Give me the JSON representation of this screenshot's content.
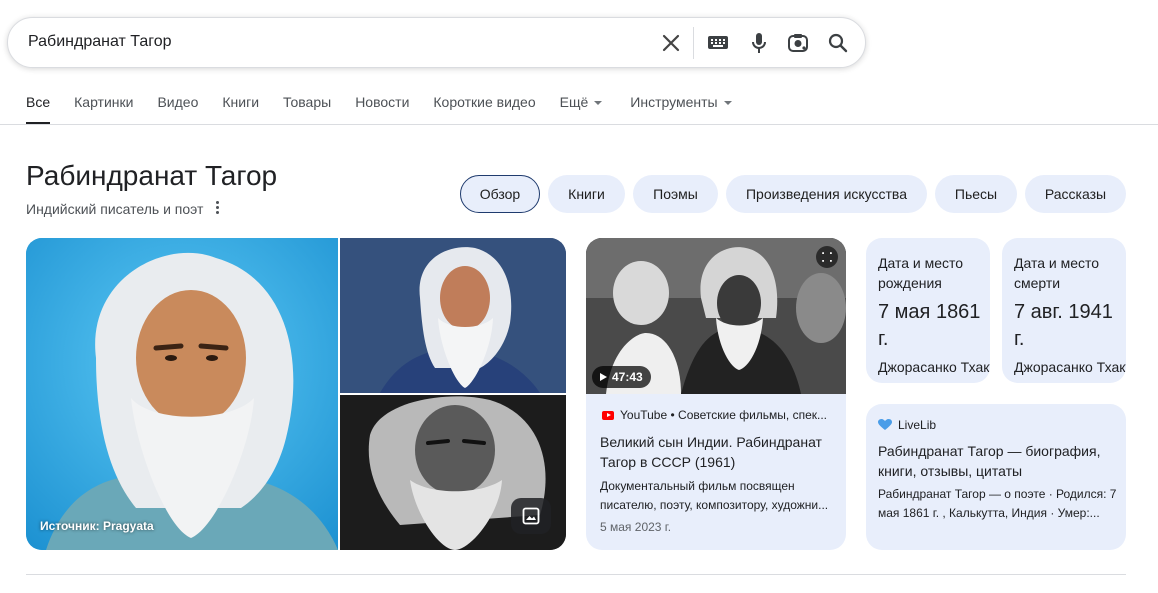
{
  "search": {
    "query": "Рабиндранат Тагор"
  },
  "tabs": [
    {
      "label": "Все"
    },
    {
      "label": "Картинки"
    },
    {
      "label": "Видео"
    },
    {
      "label": "Книги"
    },
    {
      "label": "Товары"
    },
    {
      "label": "Новости"
    },
    {
      "label": "Короткие видео"
    },
    {
      "label": "Ещё"
    },
    {
      "label": "Инструменты"
    }
  ],
  "entity": {
    "title": "Рабиндранат Тагор",
    "subtitle": "Индийский писатель и поэт"
  },
  "chips": [
    {
      "label": "Обзор"
    },
    {
      "label": "Книги"
    },
    {
      "label": "Поэмы"
    },
    {
      "label": "Произведения искусства"
    },
    {
      "label": "Пьесы"
    },
    {
      "label": "Рассказы"
    }
  ],
  "images": {
    "source_label": "Источник: Pragyata"
  },
  "video": {
    "duration": "47:43",
    "source": "YouTube • Советские фильмы, спек...",
    "title": "Великий сын Индии. Рабиндранат Тагор в СССР (1961)",
    "description": "Документальный фильм посвящен писателю, поэту, композитору, художни...",
    "date": "5 мая 2023 г."
  },
  "facts": {
    "birth": {
      "label": "Дата и место рождения",
      "value": "7 мая 1861 г.",
      "place": "Джорасанко Тхакур Бари"
    },
    "death": {
      "label": "Дата и место смерти",
      "value": "7 авг. 1941 г.",
      "place": "Джорасанко Тхакур Бари"
    }
  },
  "livelib": {
    "source": "LiveLib",
    "title": "Рабиндранат Тагор — биография, книги, отзывы, цитаты",
    "description": "Рабиндранат Тагор — о поэте · Родился: 7 мая 1861 г. , Калькутта, Индия · Умер:..."
  },
  "colors": {
    "chip_bg": "#e8eefb",
    "youtube_red": "#ff0000",
    "livelib_blue": "#4a9de8"
  }
}
